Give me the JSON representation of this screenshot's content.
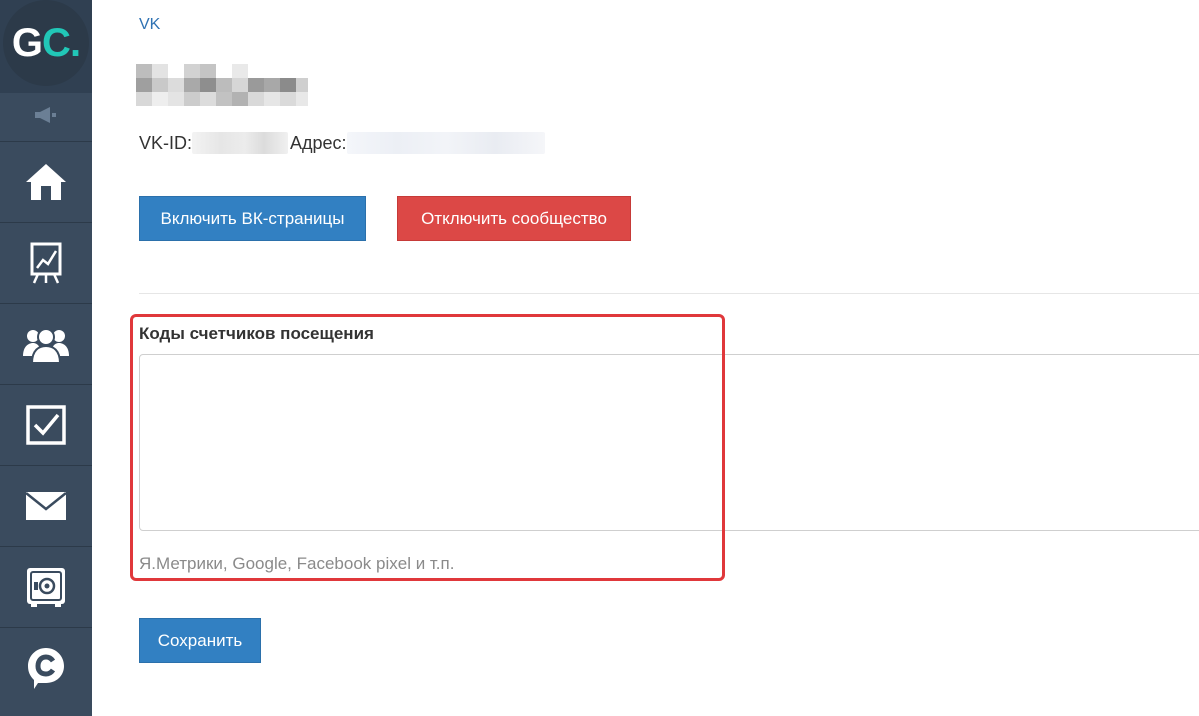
{
  "sidebar": {
    "logo": {
      "g": "G",
      "c": "C",
      "dot": "."
    },
    "items": [
      {
        "icon": "megaphone-icon"
      },
      {
        "icon": "home-icon"
      },
      {
        "icon": "chart-board-icon"
      },
      {
        "icon": "users-icon"
      },
      {
        "icon": "checkbox-icon"
      },
      {
        "icon": "envelope-icon"
      },
      {
        "icon": "safe-icon"
      },
      {
        "icon": "chat-c-icon"
      }
    ]
  },
  "main": {
    "vk_link": "VK",
    "vk_id_label": "VK-ID:",
    "address_label": "Адрес:",
    "buttons": {
      "enable": "Включить ВК-страницы",
      "disable": "Отключить сообщество",
      "save": "Сохранить"
    },
    "counters": {
      "label": "Коды счетчиков посещения",
      "value": "",
      "hint": "Я.Метрики, Google, Facebook pixel и т.п."
    }
  },
  "colors": {
    "sidebar_bg": "#3a4b5e",
    "primary_button": "#3280c2",
    "danger_button": "#dc4846",
    "highlight": "#e0383b",
    "link": "#2f72b3",
    "logo_accent": "#21c7b7"
  }
}
